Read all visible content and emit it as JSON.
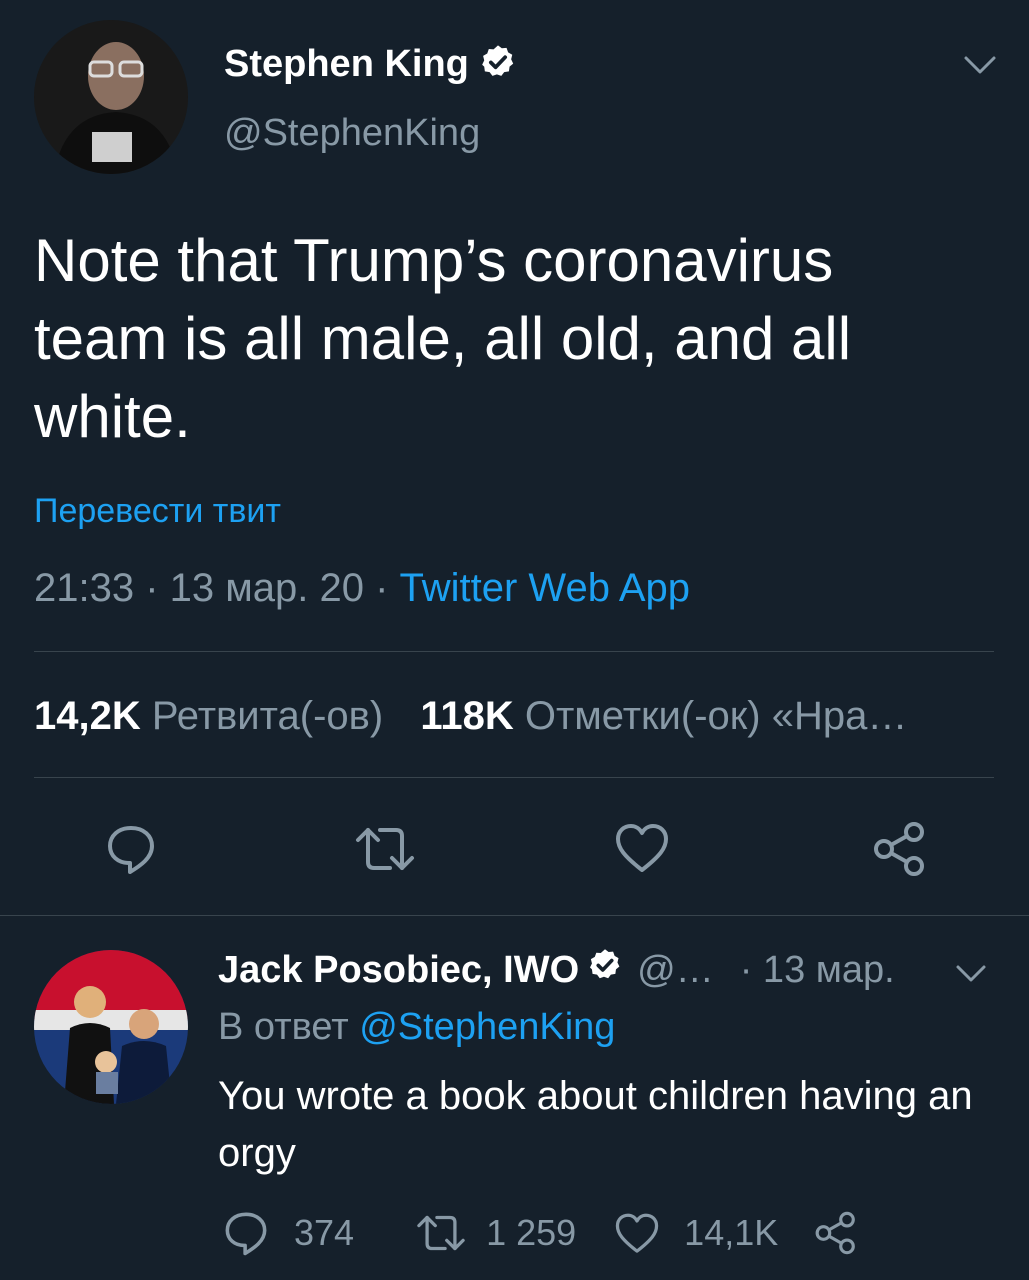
{
  "main_tweet": {
    "author_name": "Stephen King",
    "author_handle": "@StephenKing",
    "text": "Note that Trump’s coronavirus team is all male, all old, and all white.",
    "translate_label": "Перевести твит",
    "timestamp": "21:33 · 13 мар. 20 · ",
    "source": "Twitter Web App",
    "retweets_count": "14,2K",
    "retweets_label": "Ретвита(-ов)",
    "likes_count": "118K",
    "likes_label": "Отметки(-ок) «Нра…"
  },
  "reply": {
    "author_name": "Jack Posobiec, IWO",
    "author_handle": "@…",
    "date": "· 13 мар.",
    "reply_prefix": "В ответ ",
    "reply_to": "@StephenKing",
    "text": "You wrote a book about children having an orgy",
    "replies_count": "374",
    "retweets_count": "1 259",
    "likes_count": "14,1K"
  },
  "icons": {
    "verified": "verified-badge-icon",
    "chevron": "chevron-down-icon",
    "reply": "reply-icon",
    "retweet": "retweet-icon",
    "like": "like-icon",
    "share": "share-icon"
  },
  "colors": {
    "background": "#15202b",
    "accent": "#1da1f2",
    "muted": "#8899a6",
    "divider": "#38444d"
  }
}
